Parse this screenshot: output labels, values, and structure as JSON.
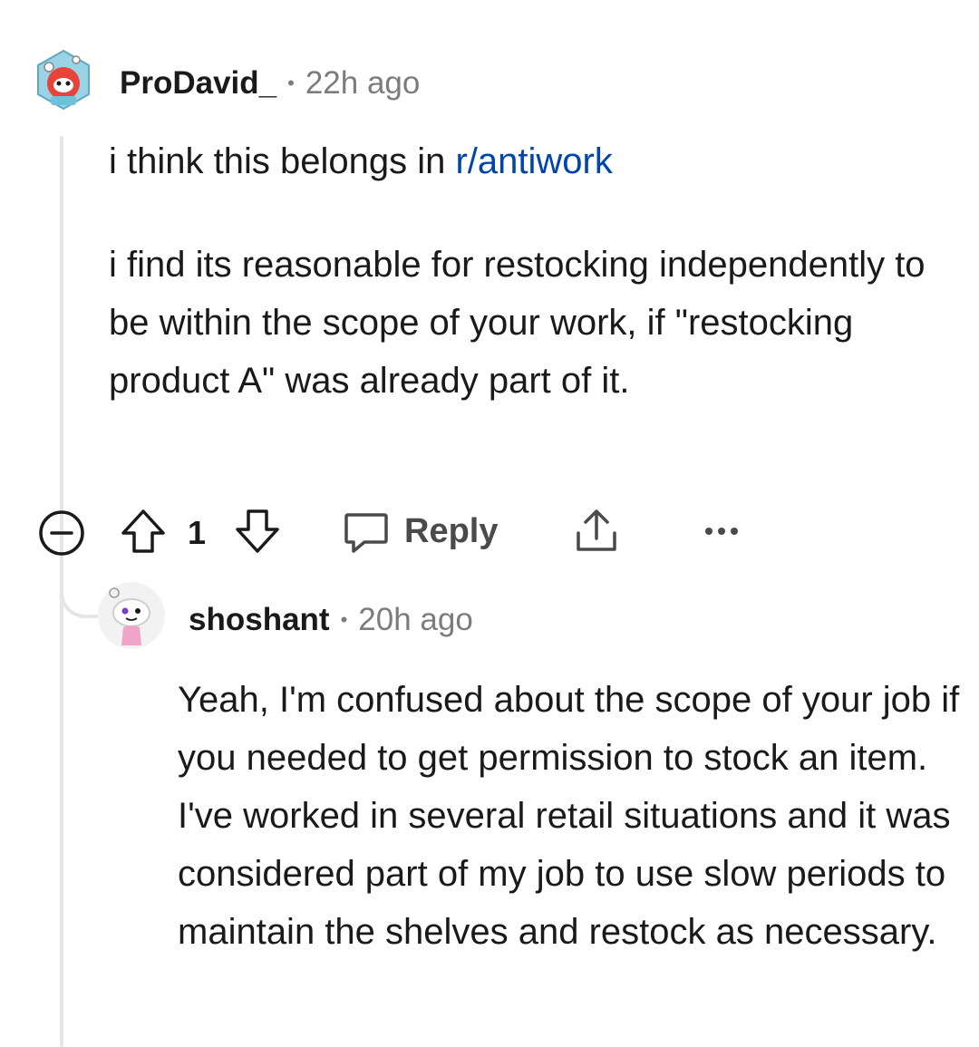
{
  "comment": {
    "username": "ProDavid_",
    "separator": "•",
    "time": "22h ago",
    "body": {
      "p1_text": "i think this belongs in ",
      "p1_link": "r/antiwork",
      "p2": "i find its reasonable for restocking independently to be within the scope of your work, if \"restocking product A\" was already part of it."
    },
    "score": "1",
    "reply_label": "Reply"
  },
  "reply": {
    "username": "shoshant",
    "separator": "•",
    "time": "20h ago",
    "body": "Yeah, I'm confused about the scope of your job if you needed to get permission to stock an item. I've worked in several retail situations and it was considered part of my job to use slow periods to maintain the shelves and restock as necessary."
  },
  "colors": {
    "link": "#0045ac",
    "muted": "#7c7c7c",
    "thread_line": "#e6e6e6"
  }
}
